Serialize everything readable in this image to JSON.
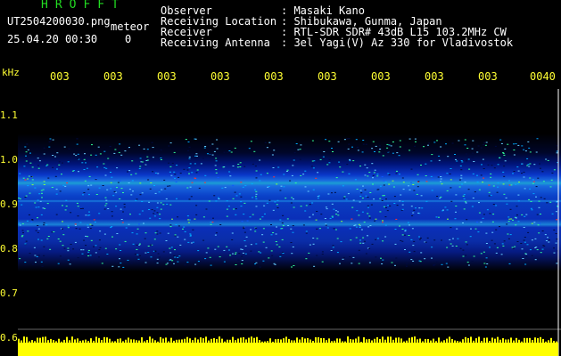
{
  "header": {
    "app_name": "HROFFT",
    "file_name": "UT2504200030.png",
    "meteor_label": "meteor",
    "datetime": "25.04.20 00:30",
    "meteor_count": "0"
  },
  "metadata": [
    {
      "label": "Observer",
      "value": ": Masaki Kano"
    },
    {
      "label": "Receiving Location",
      "value": ": Shibukawa, Gunma, Japan"
    },
    {
      "label": "Receiver",
      "value": ": RTL-SDR SDR# 43dB L15 103.2MHz CW"
    },
    {
      "label": "Receiving Antenna",
      "value": ": 3el Yagi(V) Az 330 for Vladivostok"
    }
  ],
  "spectrogram": {
    "unit_label": "kHz",
    "y_ticks": [
      "1.1",
      "1.0",
      "0.9",
      "0.8",
      "0.7",
      "0.6"
    ],
    "x_ticks": [
      "003",
      "003",
      "003",
      "003",
      "003",
      "003",
      "003",
      "003",
      "003",
      "0040"
    ],
    "colors": {
      "background": "#000000",
      "text": "#ffffff",
      "axis_labels": "#ffff33",
      "title": "#22dd22"
    }
  }
}
